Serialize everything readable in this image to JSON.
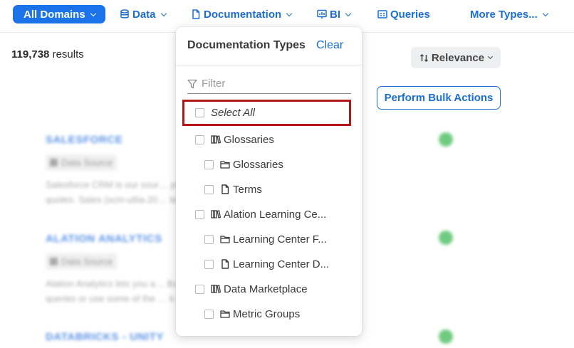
{
  "nav": {
    "all_domains": "All Domains",
    "data": "Data",
    "documentation": "Documentation",
    "bi": "BI",
    "queries": "Queries",
    "more_types": "More Types..."
  },
  "results": {
    "count": "119,738",
    "count_suffix": "results",
    "sort_label": "Relevance",
    "bulk_actions": "Perform Bulk Actions",
    "items": [
      {
        "title": "SALESFORCE",
        "badge": "Data Source",
        "desc_line1": "Salesforce CRM is our sour… product pricing, and",
        "desc_line2": "quotes. Sales (scm-ultia-20… te..."
      },
      {
        "title": "ALATION ANALYTICS",
        "badge": "Data Source",
        "desc_line1": "Alation Analytics lets you a… Build your own",
        "desc_line2": "queries or use some of the … k out Al..."
      },
      {
        "title": "DATABRICKS - UNITY",
        "badge": "",
        "desc_line1": "",
        "desc_line2": ""
      }
    ]
  },
  "dropdown": {
    "title": "Documentation Types",
    "clear": "Clear",
    "filter_placeholder": "Filter",
    "items": [
      {
        "label": "Select All",
        "icon": "none"
      },
      {
        "label": "Glossaries",
        "icon": "library-icon"
      },
      {
        "label": "Glossaries",
        "icon": "folder-icon"
      },
      {
        "label": "Terms",
        "icon": "document-icon"
      },
      {
        "label": "Alation Learning Ce...",
        "icon": "library-icon"
      },
      {
        "label": "Learning Center F...",
        "icon": "folder-icon"
      },
      {
        "label": "Learning Center D...",
        "icon": "document-icon"
      },
      {
        "label": "Data Marketplace",
        "icon": "library-icon"
      },
      {
        "label": "Metric Groups",
        "icon": "folder-icon"
      }
    ]
  },
  "colors": {
    "primary": "#1a73e8",
    "link": "#1a6fd1",
    "highlight": "#b01818",
    "success": "#58c36b"
  }
}
